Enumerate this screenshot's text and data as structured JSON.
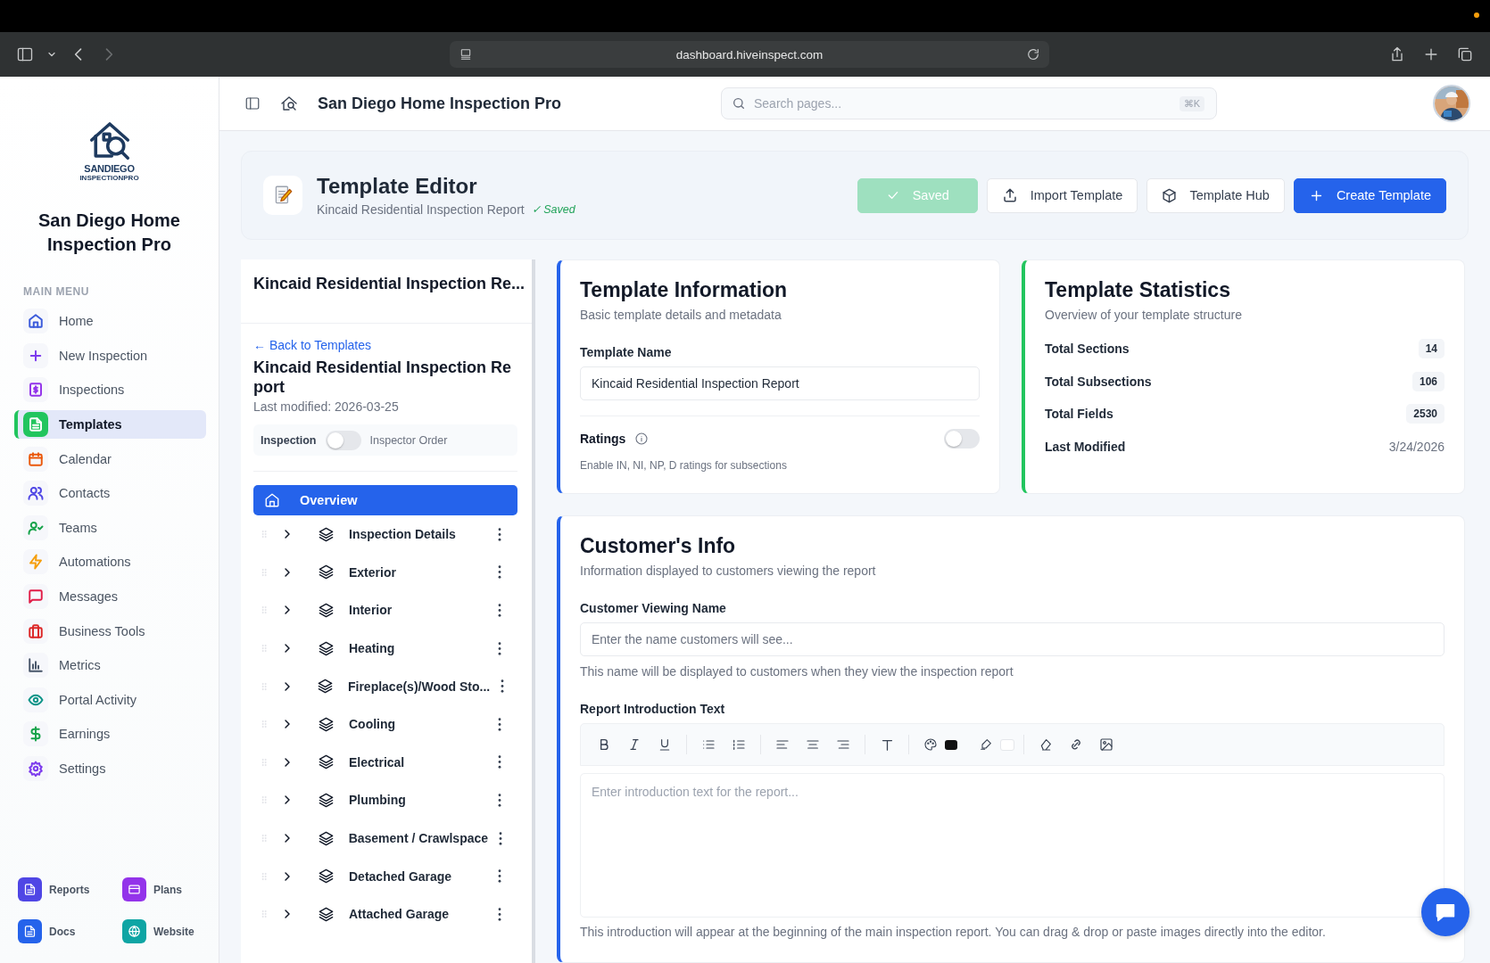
{
  "browser": {
    "url": "dashboard.hiveinspect.com"
  },
  "sidebar": {
    "brand": "San Diego Home Inspection Pro",
    "logo_line_1": "SANDIEGO",
    "logo_line_2": "INSPECTIONPRO",
    "section_label": "MAIN MENU",
    "items": [
      {
        "label": "Home",
        "color": "#3b5bdb",
        "selected": false
      },
      {
        "label": "New Inspection",
        "color": "#7c3aed",
        "selected": false
      },
      {
        "label": "Inspections",
        "color": "#9333ea",
        "selected": false
      },
      {
        "label": "Templates",
        "color": "#22c55e",
        "selected": true
      },
      {
        "label": "Calendar",
        "color": "#ea580c",
        "selected": false
      },
      {
        "label": "Contacts",
        "color": "#4f46e5",
        "selected": false
      },
      {
        "label": "Teams",
        "color": "#16a34a",
        "selected": false
      },
      {
        "label": "Automations",
        "color": "#f59e0b",
        "selected": false
      },
      {
        "label": "Messages",
        "color": "#e11d48",
        "selected": false
      },
      {
        "label": "Business Tools",
        "color": "#dc2626",
        "selected": false
      },
      {
        "label": "Metrics",
        "color": "#475569",
        "selected": false
      },
      {
        "label": "Portal Activity",
        "color": "#0d9488",
        "selected": false
      },
      {
        "label": "Earnings",
        "color": "#16a34a",
        "selected": false
      },
      {
        "label": "Settings",
        "color": "#7c3aed",
        "selected": false
      }
    ],
    "shortcuts": [
      {
        "label": "Reports",
        "color": "#4f46e5"
      },
      {
        "label": "Plans",
        "color": "#9333ea"
      },
      {
        "label": "Docs",
        "color": "#2563eb"
      },
      {
        "label": "Website",
        "color": "#0ea5a4"
      }
    ]
  },
  "header": {
    "title": "San Diego Home Inspection Pro",
    "search": {
      "placeholder": "Search pages...",
      "shortcut": "⌘K"
    }
  },
  "editor_header": {
    "title": "Template Editor",
    "subtitle": "Kincaid Residential Inspection Report",
    "saved_note": "✓ Saved",
    "buttons": [
      {
        "label": "Saved",
        "kind": "saved"
      },
      {
        "label": "Import Template",
        "kind": "import"
      },
      {
        "label": "Template Hub",
        "kind": "hub"
      },
      {
        "label": "Create Template",
        "kind": "create"
      }
    ]
  },
  "outline": {
    "title": "Kincaid Residential Inspection Re...",
    "back_link": "← Back to Templates",
    "report_title": "Kincaid Residential Inspection Report",
    "last_modified": "Last modified: 2026-03-25",
    "view_toggle": {
      "left_label": "Inspection",
      "right_label": "Inspector Order",
      "on": false
    },
    "overview": {
      "label": "Overview",
      "selected": true
    },
    "sections": [
      {
        "label": "Inspection Details"
      },
      {
        "label": "Exterior"
      },
      {
        "label": "Interior"
      },
      {
        "label": "Heating"
      },
      {
        "label": "Fireplace(s)/Wood Sto..."
      },
      {
        "label": "Cooling"
      },
      {
        "label": "Electrical"
      },
      {
        "label": "Plumbing"
      },
      {
        "label": "Basement / Crawlspace"
      },
      {
        "label": "Detached Garage"
      },
      {
        "label": "Attached Garage"
      }
    ]
  },
  "info_card": {
    "title": "Template Information",
    "subtitle": "Basic template details and metadata",
    "name_label": "Template Name",
    "name_value": "Kincaid Residential Inspection Report",
    "ratings_label": "Ratings",
    "ratings_on": false,
    "ratings_hint": "Enable IN, NI, NP, D ratings for subsections"
  },
  "stats_card": {
    "title": "Template Statistics",
    "subtitle": "Overview of your template structure",
    "rows": [
      {
        "label": "Total Sections",
        "value": "14",
        "kind": "badge"
      },
      {
        "label": "Total Subsections",
        "value": "106",
        "kind": "badge"
      },
      {
        "label": "Total Fields",
        "value": "2530",
        "kind": "badge"
      },
      {
        "label": "Last Modified",
        "value": "3/24/2026",
        "kind": "plain"
      }
    ]
  },
  "customer_card": {
    "title": "Customer's Info",
    "subtitle": "Information displayed to customers viewing the report",
    "viewing_label": "Customer Viewing Name",
    "viewing_placeholder": "Enter the name customers will see...",
    "viewing_hint": "This name will be displayed to customers when they view the inspection report",
    "intro_label": "Report Introduction Text",
    "intro_placeholder": "Enter introduction text for the report...",
    "intro_hint": "This introduction will appear at the beginning of the main inspection report. You can drag & drop or paste images directly into the editor."
  }
}
